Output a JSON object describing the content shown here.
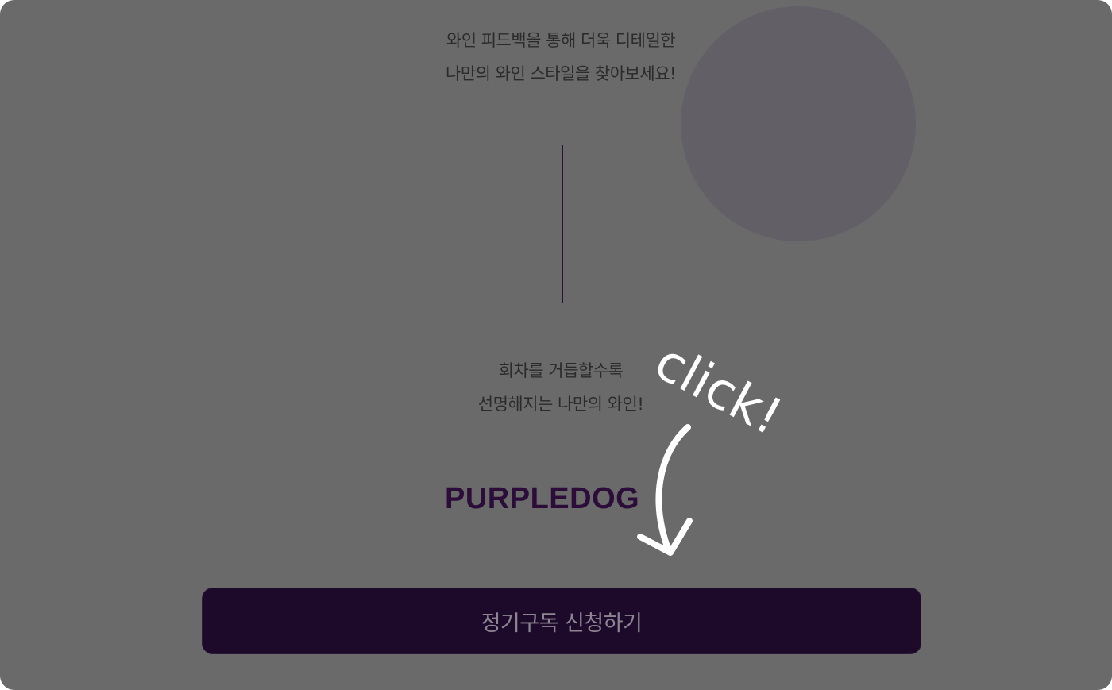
{
  "intro": {
    "line1": "와인 피드백을 통해 더욱 디테일한",
    "line2": "나만의 와인 스타일을 찾아보세요!"
  },
  "middle": {
    "line1": "회차를 거듭할수록",
    "line2": "선명해지는 나만의 와인!"
  },
  "brand": {
    "logo_text": "PURPLEDOG"
  },
  "cta": {
    "label": "정기구독 신청하기"
  },
  "annotation": {
    "text": "click!",
    "icon": "curved-arrow-down-icon"
  },
  "colors": {
    "overlay": "#6a6a6a",
    "brand_purple": "#2c0d3a",
    "button_bg": "#1d0a2b",
    "annotation": "#ffffff"
  }
}
